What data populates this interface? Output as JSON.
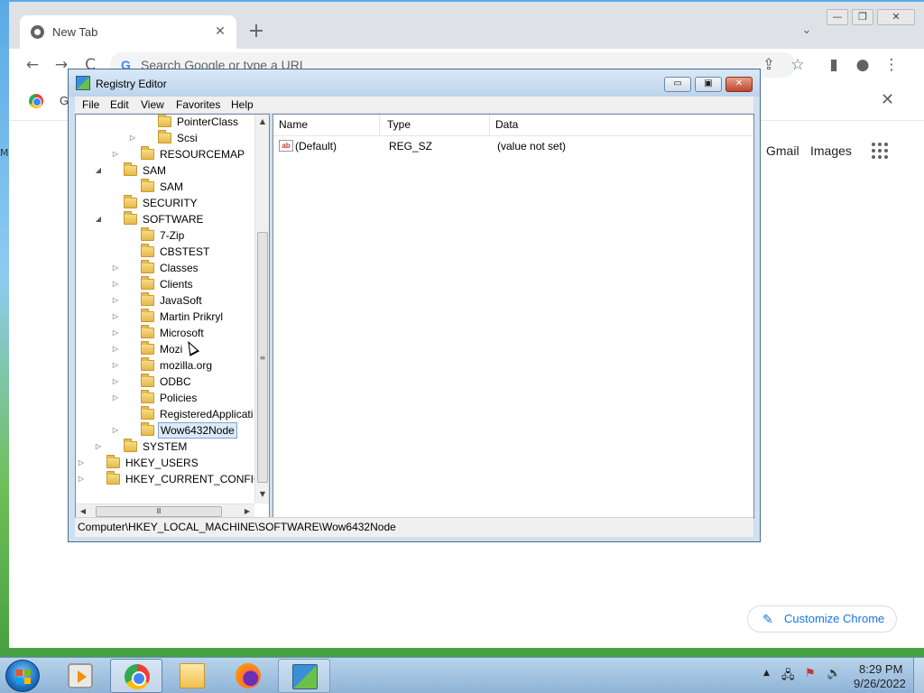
{
  "chrome": {
    "tab_title": "New Tab",
    "tab_close": "✕",
    "new_tab": "+",
    "tabs_dropdown": "⌄",
    "win_minimize": "—",
    "win_restore": "❐",
    "win_close": "✕",
    "back": "←",
    "forward": "→",
    "reload": "C",
    "omnibox_g": "G",
    "omnibox_placeholder": "Search Google or type a URL",
    "share": "⇪",
    "star": "☆",
    "side_panel": "▮",
    "profile": "●",
    "menu": "⋮",
    "bar2_text": "G",
    "bar2_close": "✕",
    "ntp_links": [
      "Gmail",
      "Images"
    ],
    "customize_label": "Customize Chrome",
    "pencil": "✎",
    "left_edge_text": "M"
  },
  "regedit": {
    "title": "Registry Editor",
    "buttons": {
      "minimize": "▭",
      "maximize": "▣",
      "close": "✕"
    },
    "menu": [
      "File",
      "Edit",
      "View",
      "Favorites",
      "Help"
    ],
    "tree": [
      {
        "label": "PointerClass",
        "exp": ""
      },
      {
        "label": "Scsi",
        "exp": "▷"
      },
      {
        "label": "RESOURCEMAP",
        "exp": "▷"
      },
      {
        "label": "SAM",
        "exp": "◢"
      },
      {
        "label": "SAM",
        "exp": ""
      },
      {
        "label": "SECURITY",
        "exp": ""
      },
      {
        "label": "SOFTWARE",
        "exp": "◢"
      },
      {
        "label": "7-Zip",
        "exp": ""
      },
      {
        "label": "CBSTEST",
        "exp": ""
      },
      {
        "label": "Classes",
        "exp": "▷"
      },
      {
        "label": "Clients",
        "exp": "▷"
      },
      {
        "label": "JavaSoft",
        "exp": "▷"
      },
      {
        "label": "Martin Prikryl",
        "exp": "▷"
      },
      {
        "label": "Microsoft",
        "exp": "▷"
      },
      {
        "label": "Mozi",
        "exp": "▷"
      },
      {
        "label": "mozilla.org",
        "exp": "▷"
      },
      {
        "label": "ODBC",
        "exp": "▷"
      },
      {
        "label": "Policies",
        "exp": "▷"
      },
      {
        "label": "RegisteredApplicati",
        "exp": ""
      },
      {
        "label": "Wow6432Node",
        "exp": "▷"
      },
      {
        "label": "SYSTEM",
        "exp": "▷"
      },
      {
        "label": "HKEY_USERS",
        "exp": "▷"
      },
      {
        "label": "HKEY_CURRENT_CONFIG",
        "exp": "▷"
      }
    ],
    "scroll": {
      "up": "▲",
      "down": "▼",
      "left": "◀",
      "right": "▶",
      "vgrip": "≡",
      "hgrip": "Ⅲ"
    },
    "columns": [
      "Name",
      "Type",
      "Data"
    ],
    "rows": [
      {
        "icon": "ab",
        "name": "(Default)",
        "type": "REG_SZ",
        "data": "(value not set)"
      }
    ],
    "status_path": "Computer\\HKEY_LOCAL_MACHINE\\SOFTWARE\\Wow6432Node"
  },
  "taskbar": {
    "time": "8:29 PM",
    "date": "9/26/2022",
    "tray_icons": [
      "▲",
      "🖧",
      "⚑",
      "🔊"
    ]
  },
  "colors": {
    "chrome_accent": "#1a73e8",
    "selection": "#dceaf8"
  }
}
